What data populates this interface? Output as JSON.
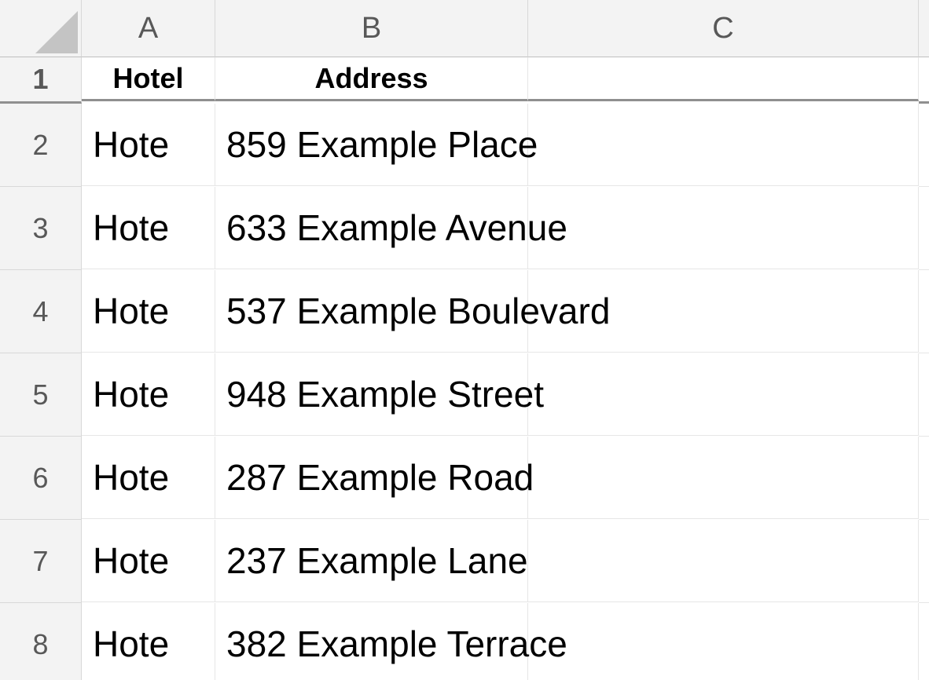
{
  "columns": {
    "A": "A",
    "B": "B",
    "C": "C"
  },
  "row_numbers": [
    "1",
    "2",
    "3",
    "4",
    "5",
    "6",
    "7",
    "8"
  ],
  "header_row": {
    "hotel": "Hotel",
    "address": "Address",
    "c": ""
  },
  "rows": [
    {
      "hotel": "Hote",
      "address": "859 Example Place"
    },
    {
      "hotel": "Hote",
      "address": "633 Example Avenue"
    },
    {
      "hotel": "Hote",
      "address": "537 Example Boulevard"
    },
    {
      "hotel": "Hote",
      "address": "948 Example Street"
    },
    {
      "hotel": "Hote",
      "address": "287 Example Road"
    },
    {
      "hotel": "Hote",
      "address": "237 Example Lane"
    },
    {
      "hotel": "Hote",
      "address": "382 Example Terrace"
    }
  ]
}
